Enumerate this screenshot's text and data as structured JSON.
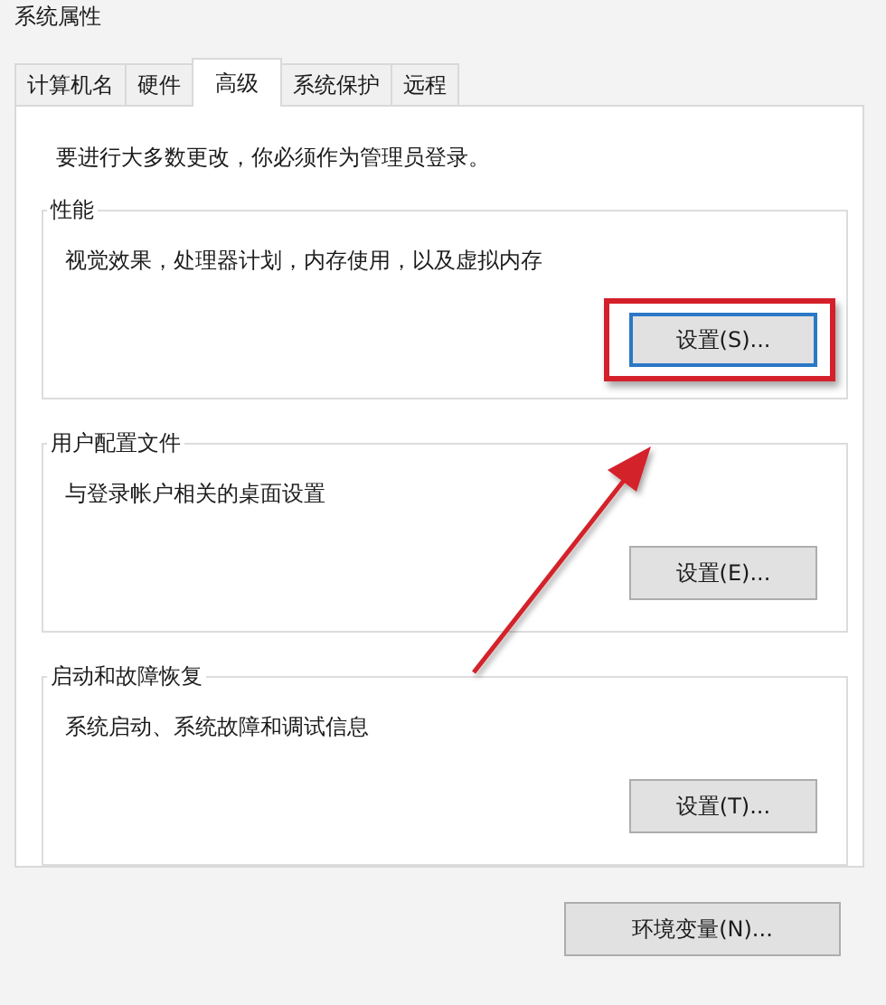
{
  "window": {
    "title": "系统属性"
  },
  "tabs": [
    {
      "label": "计算机名",
      "selected": false
    },
    {
      "label": "硬件",
      "selected": false
    },
    {
      "label": "高级",
      "selected": true
    },
    {
      "label": "系统保护",
      "selected": false
    },
    {
      "label": "远程",
      "selected": false
    }
  ],
  "notice": "要进行大多数更改，你必须作为管理员登录。",
  "groups": [
    {
      "title": "性能",
      "description": "视觉效果，处理器计划，内存使用，以及虚拟内存",
      "button": "设置(S)...",
      "focused": true,
      "highlighted": true
    },
    {
      "title": "用户配置文件",
      "description": "与登录帐户相关的桌面设置",
      "button": "设置(E)...",
      "focused": false,
      "highlighted": false
    },
    {
      "title": "启动和故障恢复",
      "description": "系统启动、系统故障和调试信息",
      "button": "设置(T)...",
      "focused": false,
      "highlighted": false
    }
  ],
  "env_button": "环境变量(N)..."
}
